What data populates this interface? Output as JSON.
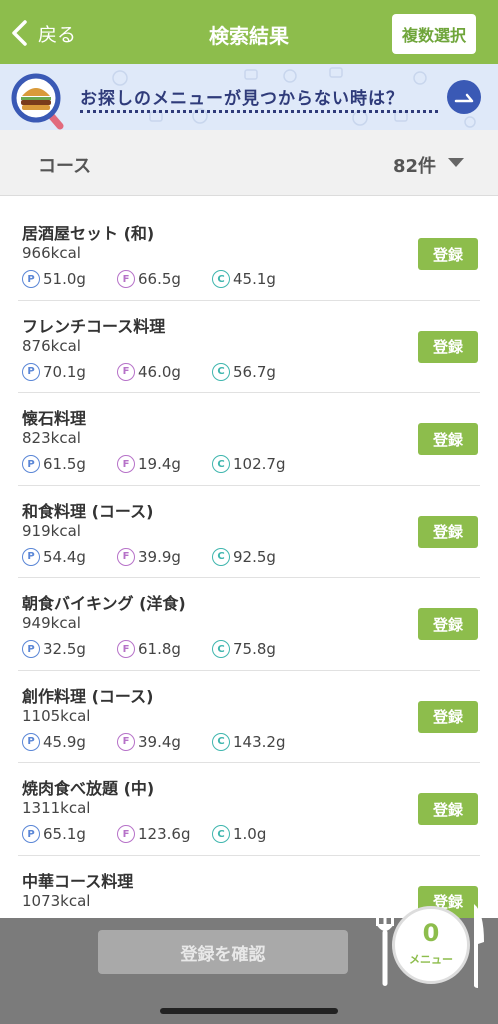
{
  "header": {
    "back_label": "戻る",
    "title": "検索結果",
    "multi_select_label": "複数選択"
  },
  "banner": {
    "text": "お探しのメニューが見つからない時は？"
  },
  "filter": {
    "category": "コース",
    "count": "82件"
  },
  "macro_letters": {
    "p": "P",
    "f": "F",
    "c": "C"
  },
  "items": [
    {
      "name": "居酒屋セット (和)",
      "kcal": "966kcal",
      "p": "51.0g",
      "f": "66.5g",
      "c": "45.1g",
      "button": "登録"
    },
    {
      "name": "フレンチコース料理",
      "kcal": "876kcal",
      "p": "70.1g",
      "f": "46.0g",
      "c": "56.7g",
      "button": "登録"
    },
    {
      "name": "懐石料理",
      "kcal": "823kcal",
      "p": "61.5g",
      "f": "19.4g",
      "c": "102.7g",
      "button": "登録"
    },
    {
      "name": "和食料理 (コース)",
      "kcal": "919kcal",
      "p": "54.4g",
      "f": "39.9g",
      "c": "92.5g",
      "button": "登録"
    },
    {
      "name": "朝食バイキング (洋食)",
      "kcal": "949kcal",
      "p": "32.5g",
      "f": "61.8g",
      "c": "75.8g",
      "button": "登録"
    },
    {
      "name": "創作料理 (コース)",
      "kcal": "1105kcal",
      "p": "45.9g",
      "f": "39.4g",
      "c": "143.2g",
      "button": "登録"
    },
    {
      "name": "焼肉食べ放題 (中)",
      "kcal": "1311kcal",
      "p": "65.1g",
      "f": "123.6g",
      "c": "1.0g",
      "button": "登録"
    },
    {
      "name": "中華コース料理",
      "kcal": "1073kcal",
      "p": "",
      "f": "",
      "c": "",
      "button": "登録"
    }
  ],
  "bottom": {
    "confirm_label": "登録を確認",
    "count": "0",
    "plate_label": "メニュー"
  },
  "colors": {
    "accent": "#8dbd4c",
    "banner_bg": "#dfe9f9",
    "banner_text": "#2f3b7a",
    "protein": "#5a86d6",
    "fat": "#b671c8",
    "carb": "#3fb6ae"
  }
}
